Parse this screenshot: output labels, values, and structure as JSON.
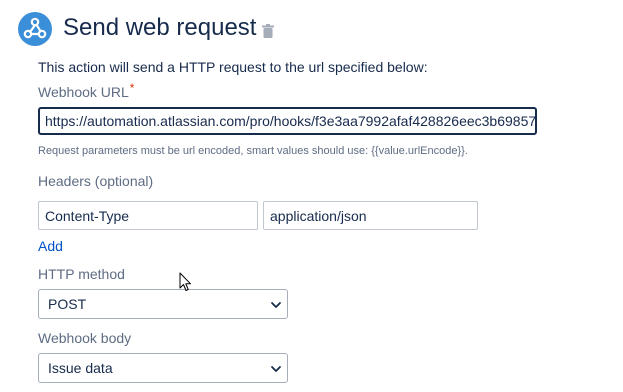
{
  "header": {
    "title": "Send web request",
    "logo_icon": "webhook-icon",
    "delete_icon": "trash-icon"
  },
  "description": "This action will send a HTTP request to the url specified below:",
  "webhook_url": {
    "label": "Webhook URL",
    "required_mark": "*",
    "value": "https://automation.atlassian.com/pro/hooks/f3e3aa7992afaf428826eec3b69857",
    "hint": "Request parameters must be url encoded, smart values should use: {{value.urlEncode}}."
  },
  "headers": {
    "label": "Headers (optional)",
    "name_value": "Content-Type",
    "value_value": "application/json",
    "add_label": "Add"
  },
  "http_method": {
    "label": "HTTP method",
    "selected": "POST"
  },
  "webhook_body": {
    "label": "Webhook body",
    "selected": "Issue data"
  },
  "colors": {
    "logo_bg": "#3b8fd8",
    "link": "#0052cc",
    "required": "#de350b"
  }
}
